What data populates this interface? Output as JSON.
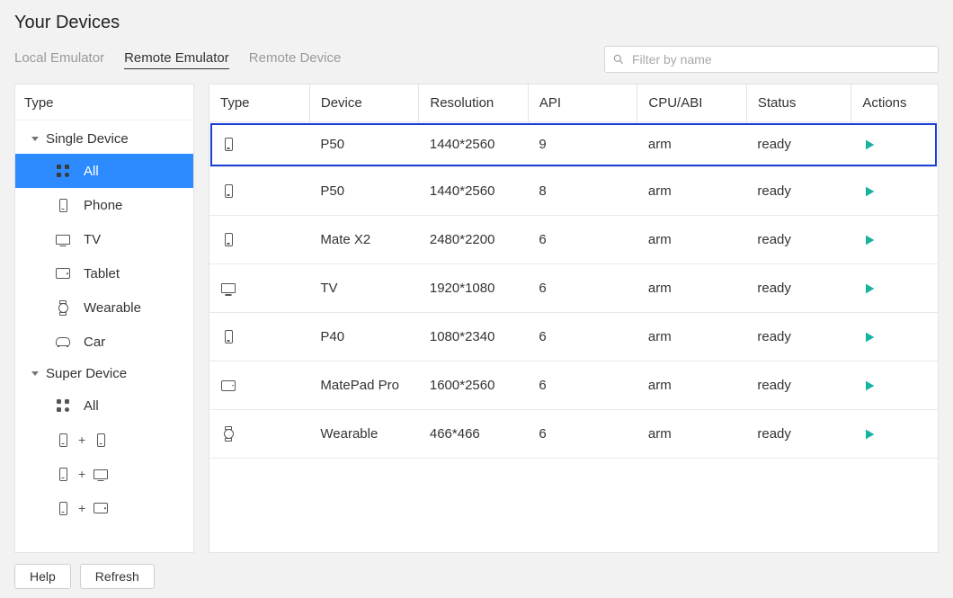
{
  "title": "Your Devices",
  "tabs": [
    "Local Emulator",
    "Remote Emulator",
    "Remote Device"
  ],
  "active_tab_index": 1,
  "search": {
    "placeholder": "Filter by name"
  },
  "sidebar": {
    "header": "Type",
    "groups": [
      {
        "label": "Single Device",
        "items": [
          {
            "id": "all",
            "label": "All",
            "icon": "all",
            "selected": true
          },
          {
            "id": "phone",
            "label": "Phone",
            "icon": "phone"
          },
          {
            "id": "tv",
            "label": "TV",
            "icon": "tv"
          },
          {
            "id": "tablet",
            "label": "Tablet",
            "icon": "tablet"
          },
          {
            "id": "wearable",
            "label": "Wearable",
            "icon": "wear"
          },
          {
            "id": "car",
            "label": "Car",
            "icon": "car"
          }
        ]
      },
      {
        "label": "Super Device",
        "items": [
          {
            "id": "sd-all",
            "label": "All",
            "icon": "all"
          }
        ],
        "combos": [
          {
            "a": "phone",
            "b": "phone"
          },
          {
            "a": "phone",
            "b": "tv"
          },
          {
            "a": "phone",
            "b": "tablet"
          }
        ]
      }
    ]
  },
  "table": {
    "columns": [
      "Type",
      "Device",
      "Resolution",
      "API",
      "CPU/ABI",
      "Status",
      "Actions"
    ],
    "col_widths": [
      "110",
      "120",
      "120",
      "120",
      "120",
      "115",
      "95"
    ],
    "rows": [
      {
        "type_icon": "phone",
        "device": "P50",
        "resolution": "1440*2560",
        "api": "9",
        "cpu": "arm",
        "status": "ready",
        "highlight": true
      },
      {
        "type_icon": "phone",
        "device": "P50",
        "resolution": "1440*2560",
        "api": "8",
        "cpu": "arm",
        "status": "ready"
      },
      {
        "type_icon": "phone",
        "device": "Mate X2",
        "resolution": "2480*2200",
        "api": "6",
        "cpu": "arm",
        "status": "ready"
      },
      {
        "type_icon": "tv",
        "device": "TV",
        "resolution": "1920*1080",
        "api": "6",
        "cpu": "arm",
        "status": "ready"
      },
      {
        "type_icon": "phone",
        "device": "P40",
        "resolution": "1080*2340",
        "api": "6",
        "cpu": "arm",
        "status": "ready"
      },
      {
        "type_icon": "tablet",
        "device": "MatePad Pro",
        "resolution": "1600*2560",
        "api": "6",
        "cpu": "arm",
        "status": "ready"
      },
      {
        "type_icon": "wear",
        "device": "Wearable",
        "resolution": "466*466",
        "api": "6",
        "cpu": "arm",
        "status": "ready"
      }
    ]
  },
  "footer": {
    "help": "Help",
    "refresh": "Refresh"
  }
}
